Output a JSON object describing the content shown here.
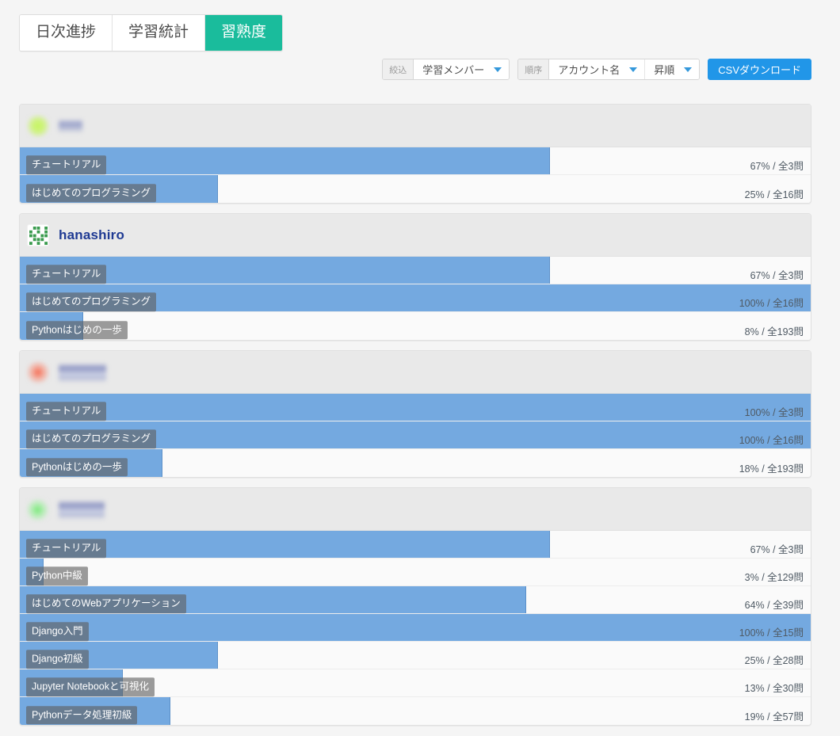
{
  "tabs": [
    {
      "label": "日次進捗",
      "active": false
    },
    {
      "label": "学習統計",
      "active": false
    },
    {
      "label": "習熟度",
      "active": true
    }
  ],
  "toolbar": {
    "filter_label": "絞込",
    "filter_value": "学習メンバー",
    "order_label": "順序",
    "order_value": "アカウント名",
    "direction_value": "昇順",
    "csv_label": "CSVダウンロード"
  },
  "colors": {
    "tab_active_bg": "#1abc9c",
    "bar": "#74a9e0",
    "csv_button": "#2196e8",
    "username": "#1f3a93"
  },
  "cards": [
    {
      "avatar": "blurred-green-avatar",
      "name": "",
      "name_blurred": true,
      "name_lines": 1,
      "name_width": 30,
      "rows": [
        {
          "course": "チュートリアル",
          "percent": 67,
          "stat": "67% / 全3問"
        },
        {
          "course": "はじめてのプログラミング",
          "percent": 25,
          "stat": "25% / 全16問"
        }
      ]
    },
    {
      "avatar": "identicon-avatar",
      "name": "hanashiro",
      "name_blurred": false,
      "name_lines": 1,
      "name_width": 0,
      "rows": [
        {
          "course": "チュートリアル",
          "percent": 67,
          "stat": "67% / 全3問"
        },
        {
          "course": "はじめてのプログラミング",
          "percent": 100,
          "stat": "100% / 全16問"
        },
        {
          "course": "Pythonはじめの一歩",
          "percent": 8,
          "stat": "8% / 全193問"
        }
      ]
    },
    {
      "avatar": "blurred-red-avatar",
      "name": "",
      "name_blurred": true,
      "name_lines": 2,
      "name_width": 60,
      "rows": [
        {
          "course": "チュートリアル",
          "percent": 100,
          "stat": "100% / 全3問"
        },
        {
          "course": "はじめてのプログラミング",
          "percent": 100,
          "stat": "100% / 全16問"
        },
        {
          "course": "Pythonはじめの一歩",
          "percent": 18,
          "stat": "18% / 全193問"
        }
      ]
    },
    {
      "avatar": "blurred-green-small-avatar",
      "name": "",
      "name_blurred": true,
      "name_lines": 2,
      "name_width": 58,
      "rows": [
        {
          "course": "チュートリアル",
          "percent": 67,
          "stat": "67% / 全3問"
        },
        {
          "course": "Python中級",
          "percent": 3,
          "stat": "3% / 全129問"
        },
        {
          "course": "はじめてのWebアプリケーション",
          "percent": 64,
          "stat": "64% / 全39問"
        },
        {
          "course": "Django入門",
          "percent": 100,
          "stat": "100% / 全15問"
        },
        {
          "course": "Django初級",
          "percent": 25,
          "stat": "25% / 全28問"
        },
        {
          "course": "Jupyter Notebookと可視化",
          "percent": 13,
          "stat": "13% / 全30問"
        },
        {
          "course": "Pythonデータ処理初級",
          "percent": 19,
          "stat": "19% / 全57問"
        }
      ]
    }
  ]
}
